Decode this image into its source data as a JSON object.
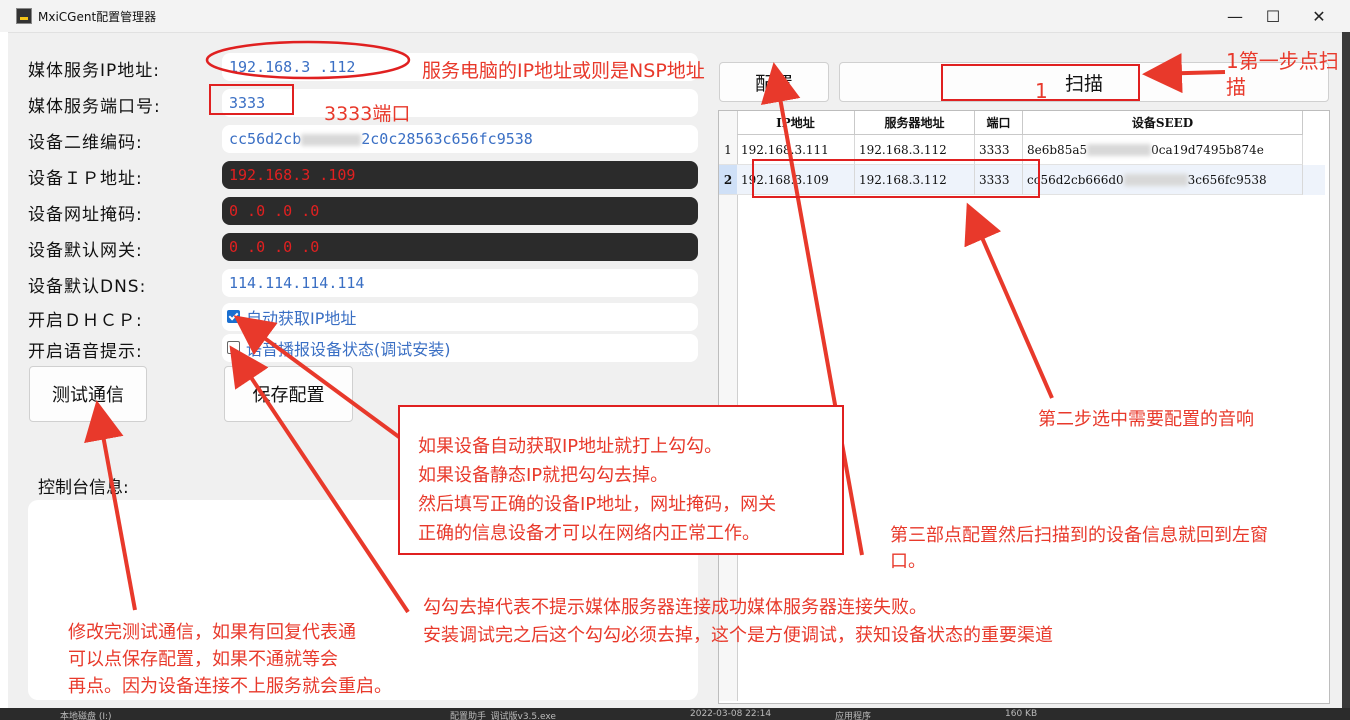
{
  "window": {
    "title": "MxiCGent配置管理器",
    "controls": {
      "minimize": "—",
      "maximize": "☐",
      "close": "✕"
    }
  },
  "form": {
    "fields": [
      {
        "label": "媒体服务IP地址:",
        "value": "192.168.3  .112"
      },
      {
        "label": "媒体服务端口号:",
        "value": "3333"
      },
      {
        "label": "设备二维编码:",
        "value_start": "cc56d2cb",
        "value_end": "2c0c28563c656fc9538"
      },
      {
        "label": "设备ＩＰ地址:",
        "value": "192.168.3  .109"
      },
      {
        "label": "设备网址掩码:",
        "value": "0  .0  .0  .0"
      },
      {
        "label": "设备默认网关:",
        "value": "0  .0  .0  .0"
      },
      {
        "label": "设备默认DNS:",
        "value": "114.114.114.114"
      }
    ],
    "dhcp": {
      "label": "开启ＤＨＣＰ:",
      "checkbox_label": "自动获取IP地址",
      "checked": true
    },
    "voice": {
      "label": "开启语音提示:",
      "checkbox_label": "语音播报设备状态(调试安装)",
      "checked": false
    },
    "test_button": "测试通信",
    "save_button": "保存配置",
    "console_label": "控制台信息:"
  },
  "toolbar": {
    "config_button": "配置",
    "scan_button": "扫描"
  },
  "device_grid": {
    "columns": [
      "IP地址",
      "服务器地址",
      "端口",
      "设备SEED"
    ],
    "rows": [
      {
        "num": "1",
        "ip": "192.168.3.111",
        "server": "192.168.3.112",
        "port": "3333",
        "seed_start": "8e6b85a5",
        "seed_end": "0ca19d7495b874e"
      },
      {
        "num": "2",
        "ip": "192.168.3.109",
        "server": "192.168.3.112",
        "port": "3333",
        "seed_start": "cc56d2cb666d0",
        "seed_end": "3c656fc9538"
      }
    ]
  },
  "annotations": {
    "nsp_note": "服务电脑的IP地址或则是NSP地址",
    "port_note": "3333端口",
    "step1": "1第一步点扫\n描",
    "step1_num": "1",
    "step2": "第二步选中需要配置的音响",
    "step3": "第三部点配置然后扫描到的设备信息就回到左窗\n口。",
    "dhcp_note": "如果设备自动获取IP地址就打上勾勾。\n如果设备静态IP就把勾勾去掉。\n然后填写正确的设备IP地址，网址掩码，网关\n正确的信息设备才可以在网络内正常工作。",
    "voice_note": "勾勾去掉代表不提示媒体服务器连接成功媒体服务器连接失败。\n安装调试完之后这个勾勾必须去掉，这个是方便调试，获知设备状态的重要渠道",
    "test_note": "修改完测试通信，如果有回复代表通\n可以点保存配置，如果不通就等会\n再点。因为设备连接不上服务就会重启。"
  },
  "taskbar": {
    "left_item": "本地磁盘 (I:)",
    "mid_item": "配置助手_调试版v3.5.exe",
    "date": "2022-03-08 22:14",
    "type": "应用程序",
    "size": "160 KB"
  },
  "colors": {
    "annotation": "#e8392b",
    "value_text": "#3a6fc4",
    "dark_field": "#2b2b2b"
  }
}
